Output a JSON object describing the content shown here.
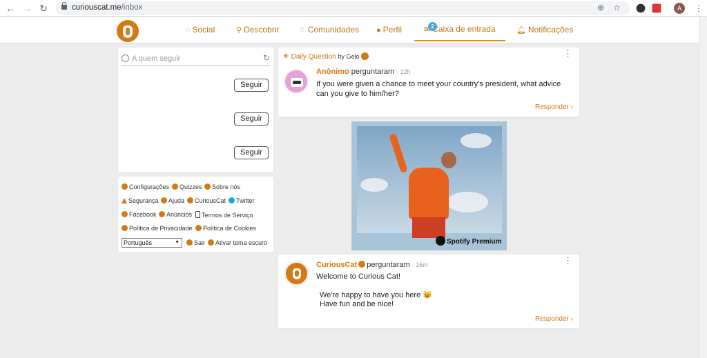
{
  "browser": {
    "url_host": "curiouscat.me",
    "url_path": "/inbox",
    "avatar_letter": "A"
  },
  "nav": {
    "social": "Social",
    "discover": "Descobrir",
    "communities": "Comunidades",
    "profile": "Perfil",
    "inbox": "Caixa de entrada",
    "inbox_badge": "2",
    "notifications": "Notificações",
    "accent_color": "#d47a14"
  },
  "who_to_follow": {
    "placeholder": "A quem seguir",
    "follow_label": "Seguir"
  },
  "footer_links": {
    "settings": "Configurações",
    "quizzes": "Quizzes",
    "about": "Sobre nós",
    "security": "Segurança",
    "help": "Ajuda",
    "curiouscat": "CuriousCat",
    "twitter": "Twitter",
    "facebook": "Facebook",
    "ads": "Anúncios",
    "terms": "Termos de Serviço",
    "privacy": "Política de Privacidade",
    "cookies": "Política de Cookies",
    "language": "Português",
    "logout": "Sair",
    "dark_theme": "Ativar tema escuro"
  },
  "daily_question": {
    "label": "Daily Question",
    "by": "by Gelo",
    "author": "Anônimo",
    "verb": "perguntaram",
    "time": "· 12h",
    "text": "If you were given a chance to meet your country's president, what advice can you give to him/her?",
    "reply": "Responder"
  },
  "ad": {
    "brand": "Spotify Premium"
  },
  "welcome": {
    "author": "CuriousCat",
    "verb": "perguntaram",
    "time": "· 16m",
    "title": "Welcome to Curious Cat!",
    "line1": "We're happy to have you here 😺",
    "line2": "Have fun and be nice!",
    "reply": "Responder"
  }
}
